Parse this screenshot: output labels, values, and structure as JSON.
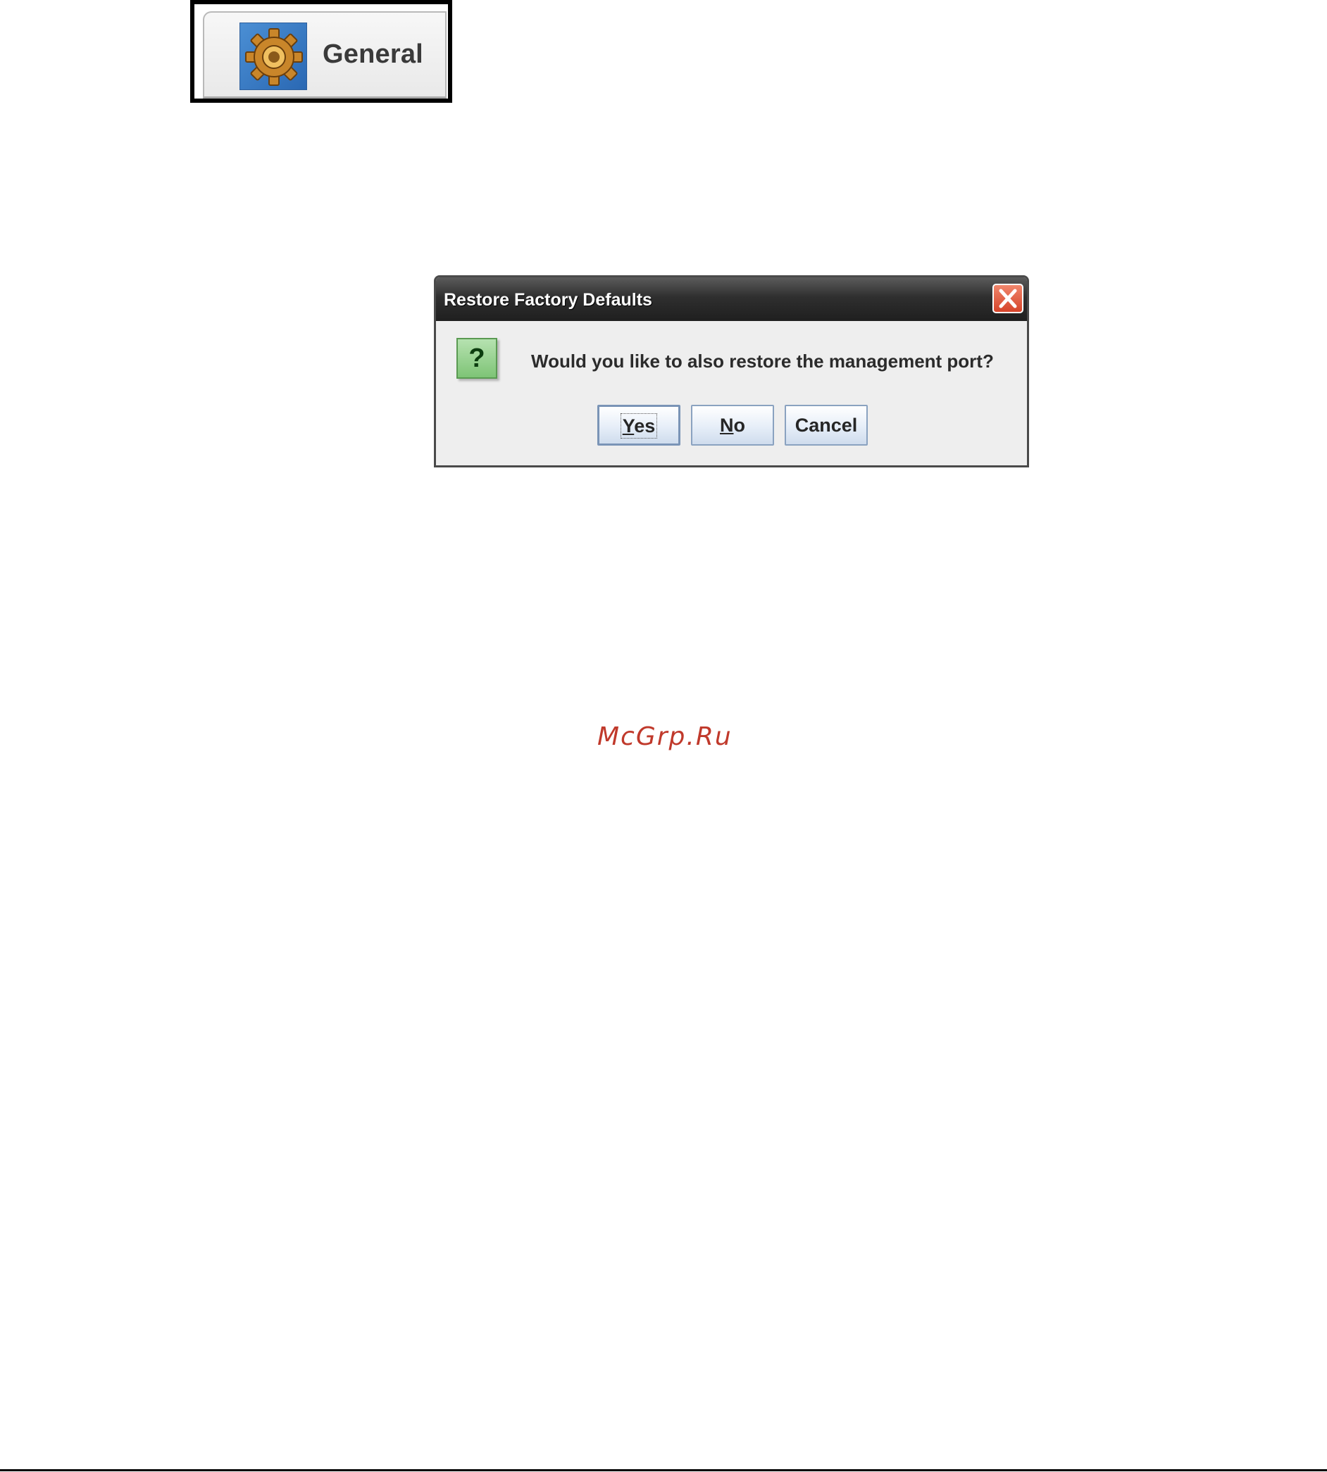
{
  "general_tab": {
    "label": "General",
    "icon": "gear-icon"
  },
  "dialog": {
    "title": "Restore Factory Defaults",
    "close_icon": "close-icon",
    "question_icon": "question-icon",
    "question_glyph": "?",
    "message": "Would you like to also restore the management port?",
    "buttons": {
      "yes": {
        "mnemonic": "Y",
        "rest": "es"
      },
      "no": {
        "mnemonic": "N",
        "rest": "o"
      },
      "cancel": {
        "label": "Cancel"
      }
    }
  },
  "watermark": "McGrp.Ru",
  "colors": {
    "titlebar": "#2f2f2f",
    "close_button": "#d6442a",
    "question_icon": "#7ec476",
    "watermark": "#c0392b"
  }
}
